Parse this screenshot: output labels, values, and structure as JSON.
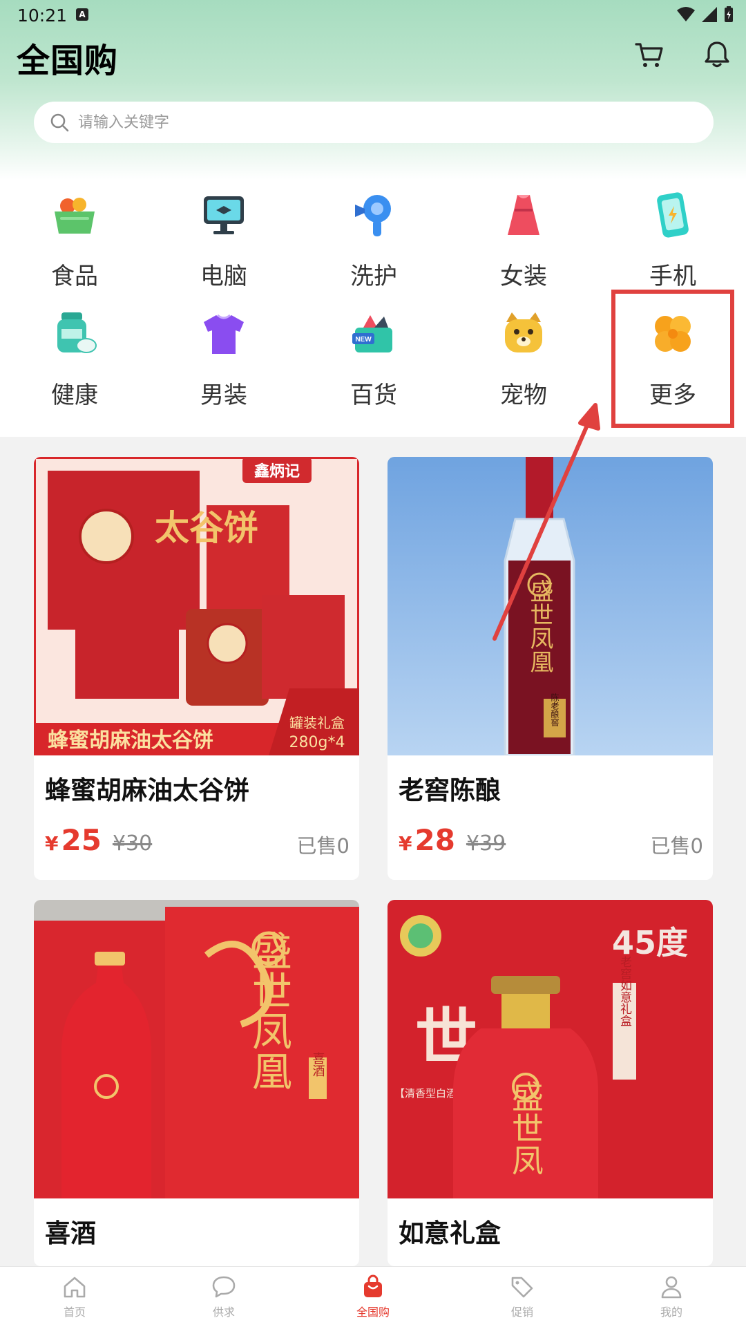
{
  "status_bar": {
    "time": "10:21"
  },
  "header": {
    "title": "全国购"
  },
  "search": {
    "placeholder": "请输入关键字"
  },
  "categories": [
    {
      "label": "食品",
      "icon": "grocery-basket-icon",
      "color": "#5cc46a"
    },
    {
      "label": "电脑",
      "icon": "monitor-icon",
      "color": "#2f3f4a"
    },
    {
      "label": "洗护",
      "icon": "hair-dryer-icon",
      "color": "#3a8ff0"
    },
    {
      "label": "女装",
      "icon": "dress-icon",
      "color": "#ee4d5f"
    },
    {
      "label": "手机",
      "icon": "phone-icon",
      "color": "#2fd0c8"
    },
    {
      "label": "健康",
      "icon": "pill-bottle-icon",
      "color": "#3fc4b0"
    },
    {
      "label": "男装",
      "icon": "tshirt-icon",
      "color": "#8a4df0"
    },
    {
      "label": "百货",
      "icon": "gift-box-icon",
      "color": "#30c4a8"
    },
    {
      "label": "宠物",
      "icon": "dog-face-icon",
      "color": "#f5c23a"
    },
    {
      "label": "更多",
      "icon": "clover-icon",
      "color": "#f7a21c"
    }
  ],
  "products": [
    {
      "title": "蜂蜜胡麻油太谷饼",
      "price_symbol": "¥",
      "price": "25",
      "original_price": "¥30",
      "sold": "已售0",
      "image": {
        "brand": "鑫炳记",
        "product": "太谷饼",
        "banner": "蜂蜜胡麻油太谷饼",
        "tag_line1": "罐装礼盒",
        "tag_line2": "280g*4"
      }
    },
    {
      "title": "老窖陈酿",
      "price_symbol": "¥",
      "price": "28",
      "original_price": "¥39",
      "sold": "已售0",
      "image": {
        "label": "盛世凤凰",
        "seal": "陈老酿窖"
      }
    },
    {
      "title": "喜酒",
      "image": {
        "label": "盛世凤凰",
        "side": "喜酒"
      }
    },
    {
      "title": "如意礼盒",
      "image": {
        "degree": "45度",
        "side": "老窖如意礼盒",
        "type": "【清香型白酒】",
        "label": "盛世凤"
      }
    }
  ],
  "bottom_nav": [
    {
      "label": "首页",
      "icon": "home-icon",
      "active": false
    },
    {
      "label": "供求",
      "icon": "chat-bubble-icon",
      "active": false
    },
    {
      "label": "全国购",
      "icon": "shopping-bag-icon",
      "active": true
    },
    {
      "label": "促销",
      "icon": "tag-icon",
      "active": false
    },
    {
      "label": "我的",
      "icon": "person-icon",
      "active": false
    }
  ],
  "colors": {
    "accent": "#e53a2e",
    "header_green": "#a6dcbf",
    "highlight": "#e0413f"
  }
}
